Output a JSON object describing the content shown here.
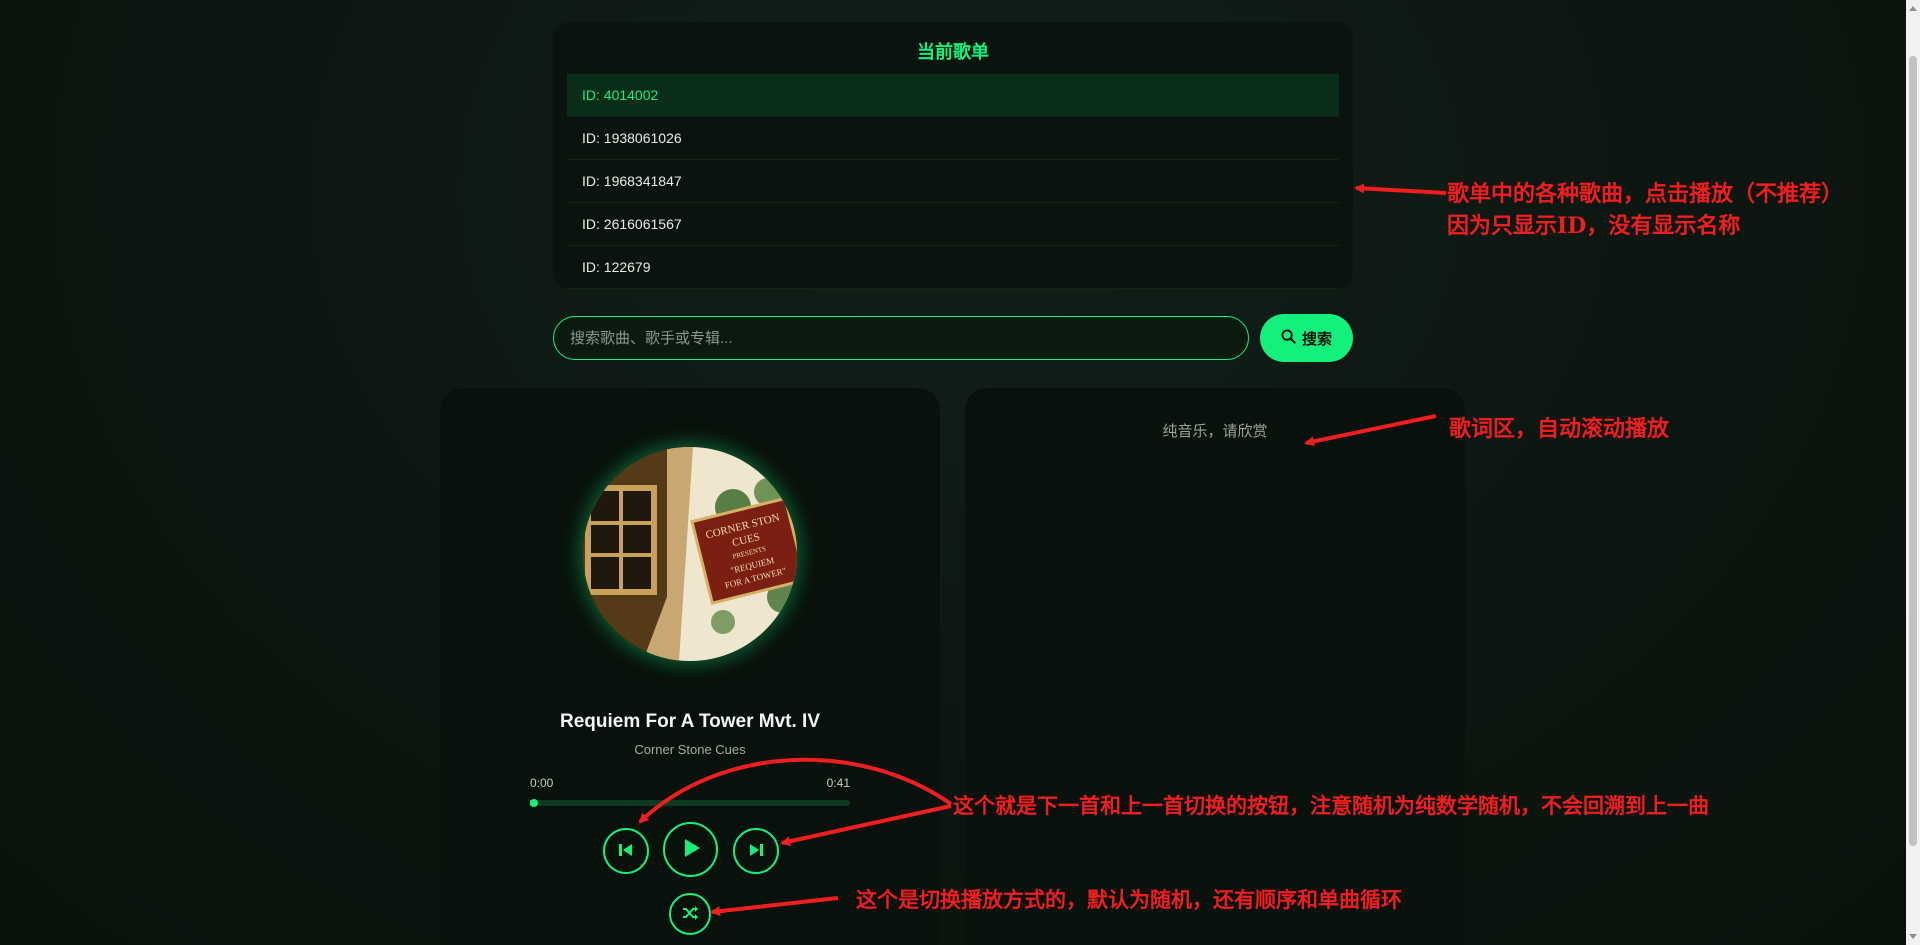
{
  "playlist": {
    "title": "当前歌单",
    "items": [
      {
        "label": "ID: 4014002"
      },
      {
        "label": "ID: 1938061026"
      },
      {
        "label": "ID: 1968341847"
      },
      {
        "label": "ID: 2616061567"
      },
      {
        "label": "ID: 122679"
      }
    ],
    "active_index": 0
  },
  "search": {
    "placeholder": "搜索歌曲、歌手或专辑...",
    "value": "",
    "button_label": "搜索"
  },
  "player": {
    "song_title": "Requiem For A Tower Mvt. IV",
    "artist": "Corner Stone Cues",
    "current_time": "0:00",
    "total_time": "0:41",
    "progress_fraction": 0.01,
    "play_mode": "shuffle"
  },
  "lyrics": {
    "text": "纯音乐，请欣赏"
  },
  "annotations": {
    "playlist_line1": "歌单中的各种歌曲，点击播放（不推荐）",
    "playlist_line2": "因为只显示ID，没有显示名称",
    "lyrics": "歌词区，自动滚动播放",
    "buttons": "这个就是下一首和上一首切换的按钮，注意随机为纯数学随机，不会回溯到上一曲",
    "mode": "这个是切换播放方式的，默认为随机，还有顺序和单曲循环"
  },
  "colors": {
    "accent": "#14f07c",
    "annotation": "#f01e1e",
    "background": "#0d1710"
  }
}
